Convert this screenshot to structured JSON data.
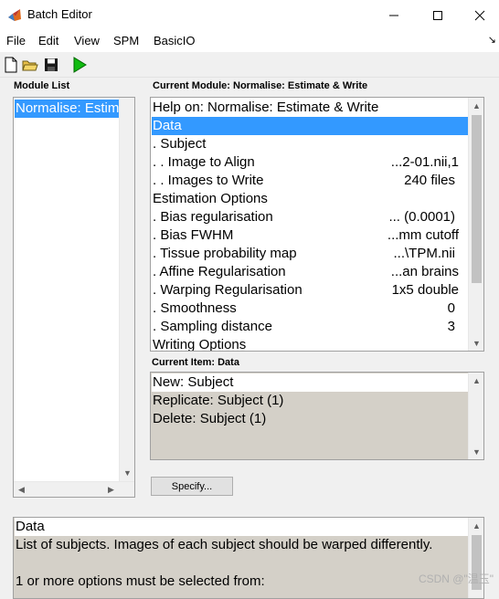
{
  "window": {
    "title": "Batch Editor",
    "icon": "matlab-logo-icon"
  },
  "menu": {
    "items": [
      "File",
      "Edit",
      "View",
      "SPM",
      "BasicIO"
    ],
    "overflow_arrow": "↘"
  },
  "toolbar": {
    "buttons": [
      "new-file-icon",
      "open-folder-icon",
      "save-icon",
      "run-icon"
    ]
  },
  "module_list": {
    "label": "Module List",
    "items": [
      "Normalise: Estimate & Write"
    ]
  },
  "current_module": {
    "label": "Current Module: Normalise: Estimate & Write",
    "rows": [
      {
        "label": "Help on: Normalise: Estimate & Write",
        "value": ""
      },
      {
        "label": "Data",
        "value": ""
      },
      {
        "label": ". Subject",
        "value": ""
      },
      {
        "label": ". . Image to Align",
        "value": "...2-01.nii,1"
      },
      {
        "label": ". . Images to Write",
        "value": "240 files"
      },
      {
        "label": "Estimation Options",
        "value": ""
      },
      {
        "label": ". Bias regularisation",
        "value": "... (0.0001)"
      },
      {
        "label": ". Bias FWHM",
        "value": "...mm cutoff"
      },
      {
        "label": ". Tissue probability map",
        "value": "...\\TPM.nii"
      },
      {
        "label": ". Affine Regularisation",
        "value": "...an brains"
      },
      {
        "label": ". Warping Regularisation",
        "value": "1x5 double"
      },
      {
        "label": ". Smoothness",
        "value": "0"
      },
      {
        "label": ". Sampling distance",
        "value": "3"
      },
      {
        "label": "Writing Options",
        "value": ""
      }
    ]
  },
  "current_item": {
    "label": "Current Item: Data",
    "items": [
      "New: Subject",
      "Replicate: Subject (1)",
      "Delete: Subject (1)"
    ]
  },
  "specify_button": "Specify...",
  "help_panel": {
    "lines": [
      "Data",
      "List of subjects. Images of each subject should be warped differently.",
      "",
      "1 or more options must be selected from:"
    ]
  },
  "watermark": "CSDN @\"温玉\"",
  "colors": {
    "selection": "#3399ff",
    "grey_fill": "#d4d0c8",
    "run_green": "#22aa22"
  }
}
